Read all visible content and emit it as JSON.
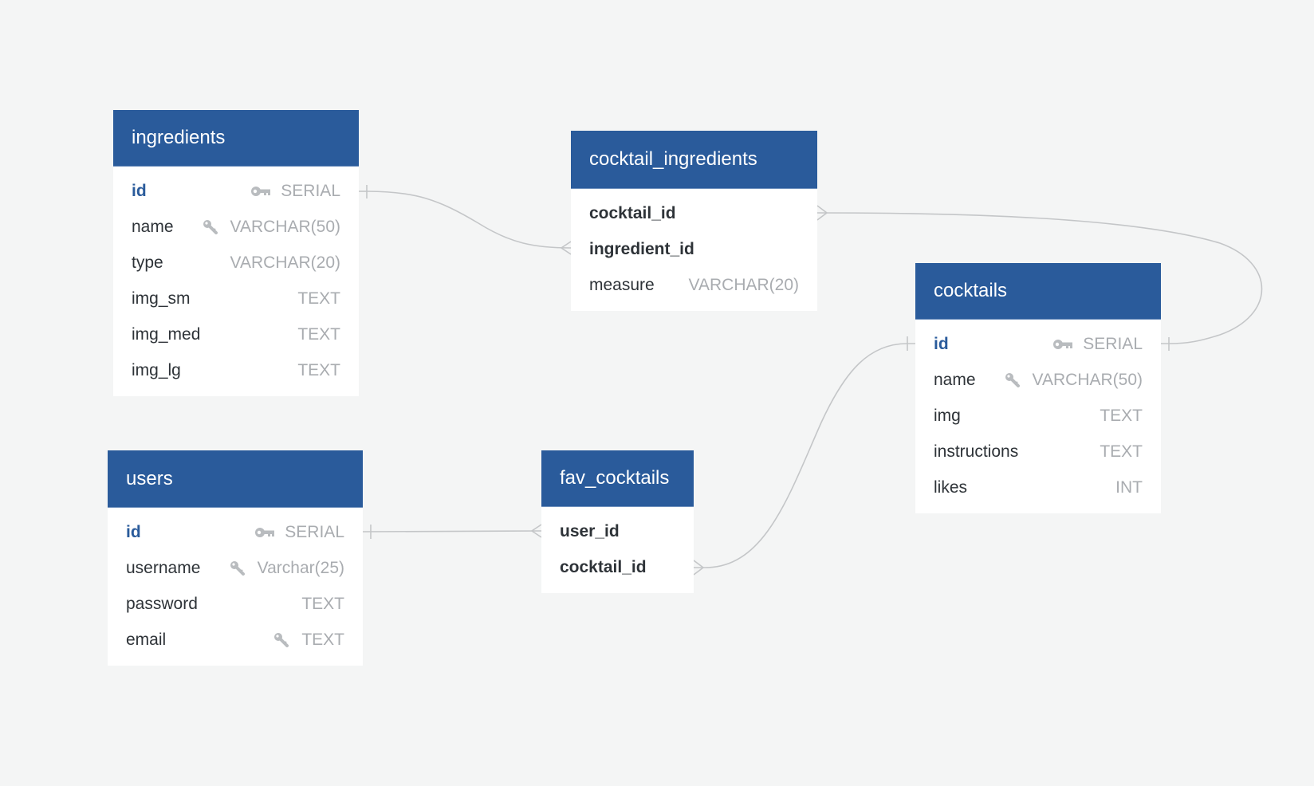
{
  "colors": {
    "header": "#2a5b9b",
    "background": "#f4f5f5",
    "connector": "#c4c6c8",
    "type_text": "#a9acb0",
    "pk_text": "#2a5b9b"
  },
  "tables": {
    "ingredients": {
      "title": "ingredients",
      "columns": [
        {
          "name": "id",
          "type": "SERIAL",
          "icon": "primary-key-icon",
          "style": "pk"
        },
        {
          "name": "name",
          "type": "VARCHAR(50)",
          "icon": "unique-key-icon",
          "style": "normal"
        },
        {
          "name": "type",
          "type": "VARCHAR(20)",
          "icon": "",
          "style": "normal"
        },
        {
          "name": "img_sm",
          "type": "TEXT",
          "icon": "",
          "style": "normal"
        },
        {
          "name": "img_med",
          "type": "TEXT",
          "icon": "",
          "style": "normal"
        },
        {
          "name": "img_lg",
          "type": "TEXT",
          "icon": "",
          "style": "normal"
        }
      ]
    },
    "cocktail_ingredients": {
      "title": "cocktail_ingredients",
      "columns": [
        {
          "name": "cocktail_id",
          "type": "",
          "icon": "",
          "style": "fk"
        },
        {
          "name": "ingredient_id",
          "type": "",
          "icon": "",
          "style": "fk"
        },
        {
          "name": "measure",
          "type": "VARCHAR(20)",
          "icon": "",
          "style": "normal"
        }
      ]
    },
    "cocktails": {
      "title": "cocktails",
      "columns": [
        {
          "name": "id",
          "type": "SERIAL",
          "icon": "primary-key-icon",
          "style": "pk"
        },
        {
          "name": "name",
          "type": "VARCHAR(50)",
          "icon": "unique-key-icon",
          "style": "normal"
        },
        {
          "name": "img",
          "type": "TEXT",
          "icon": "",
          "style": "normal"
        },
        {
          "name": "instructions",
          "type": "TEXT",
          "icon": "",
          "style": "normal"
        },
        {
          "name": "likes",
          "type": "INT",
          "icon": "",
          "style": "normal"
        }
      ]
    },
    "users": {
      "title": "users",
      "columns": [
        {
          "name": "id",
          "type": "SERIAL",
          "icon": "primary-key-icon",
          "style": "pk"
        },
        {
          "name": "username",
          "type": "Varchar(25)",
          "icon": "unique-key-icon",
          "style": "normal"
        },
        {
          "name": "password",
          "type": "TEXT",
          "icon": "",
          "style": "normal"
        },
        {
          "name": "email",
          "type": "TEXT",
          "icon": "unique-key-icon",
          "style": "normal"
        }
      ]
    },
    "fav_cocktails": {
      "title": "fav_cocktails",
      "columns": [
        {
          "name": "user_id",
          "type": "",
          "icon": "",
          "style": "fk"
        },
        {
          "name": "cocktail_id",
          "type": "",
          "icon": "",
          "style": "fk"
        }
      ]
    }
  },
  "relationships": [
    {
      "from": "ingredients.id",
      "to": "cocktail_ingredients.ingredient_id",
      "from_cardinality": "one",
      "to_cardinality": "many"
    },
    {
      "from": "cocktails.id",
      "to": "cocktail_ingredients.cocktail_id",
      "from_cardinality": "one",
      "to_cardinality": "many"
    },
    {
      "from": "users.id",
      "to": "fav_cocktails.user_id",
      "from_cardinality": "one",
      "to_cardinality": "many"
    },
    {
      "from": "cocktails.id",
      "to": "fav_cocktails.cocktail_id",
      "from_cardinality": "one",
      "to_cardinality": "many"
    }
  ]
}
